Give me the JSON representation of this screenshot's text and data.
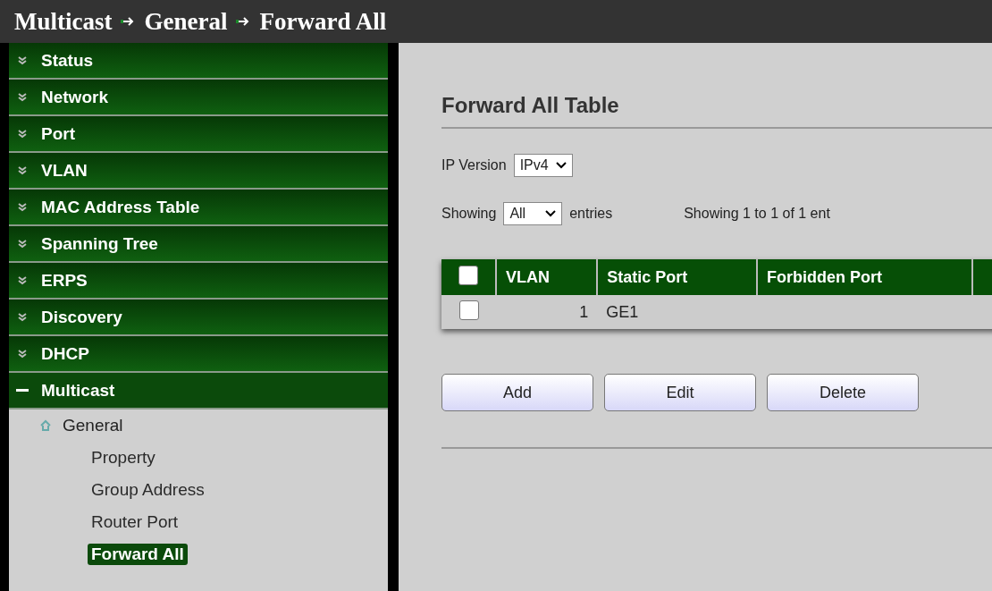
{
  "breadcrumb": [
    "Multicast",
    "General",
    "Forward All"
  ],
  "sidebar": {
    "items": [
      {
        "label": "Status",
        "expanded": false
      },
      {
        "label": "Network",
        "expanded": false
      },
      {
        "label": "Port",
        "expanded": false
      },
      {
        "label": "VLAN",
        "expanded": false
      },
      {
        "label": "MAC Address Table",
        "expanded": false
      },
      {
        "label": "Spanning Tree",
        "expanded": false
      },
      {
        "label": "ERPS",
        "expanded": false
      },
      {
        "label": "Discovery",
        "expanded": false
      },
      {
        "label": "DHCP",
        "expanded": false
      },
      {
        "label": "Multicast",
        "expanded": true,
        "children": [
          {
            "label": "General",
            "expanded": true,
            "children": [
              {
                "label": "Property",
                "selected": false
              },
              {
                "label": "Group Address",
                "selected": false
              },
              {
                "label": "Router Port",
                "selected": false
              },
              {
                "label": "Forward All",
                "selected": true
              }
            ]
          }
        ]
      }
    ]
  },
  "content": {
    "title": "Forward All Table",
    "ip_version": {
      "label": "IP Version",
      "value": "IPv4"
    },
    "showing": {
      "prefix": "Showing",
      "value": "All",
      "suffix": "entries",
      "summary": "Showing 1 to 1 of 1 ent"
    },
    "table": {
      "select_all_checked": false,
      "columns": [
        "VLAN",
        "Static Port",
        "Forbidden Port"
      ],
      "rows": [
        {
          "checked": false,
          "cells": [
            "1",
            "GE1",
            ""
          ]
        }
      ]
    },
    "buttons": [
      "Add",
      "Edit",
      "Delete"
    ]
  }
}
